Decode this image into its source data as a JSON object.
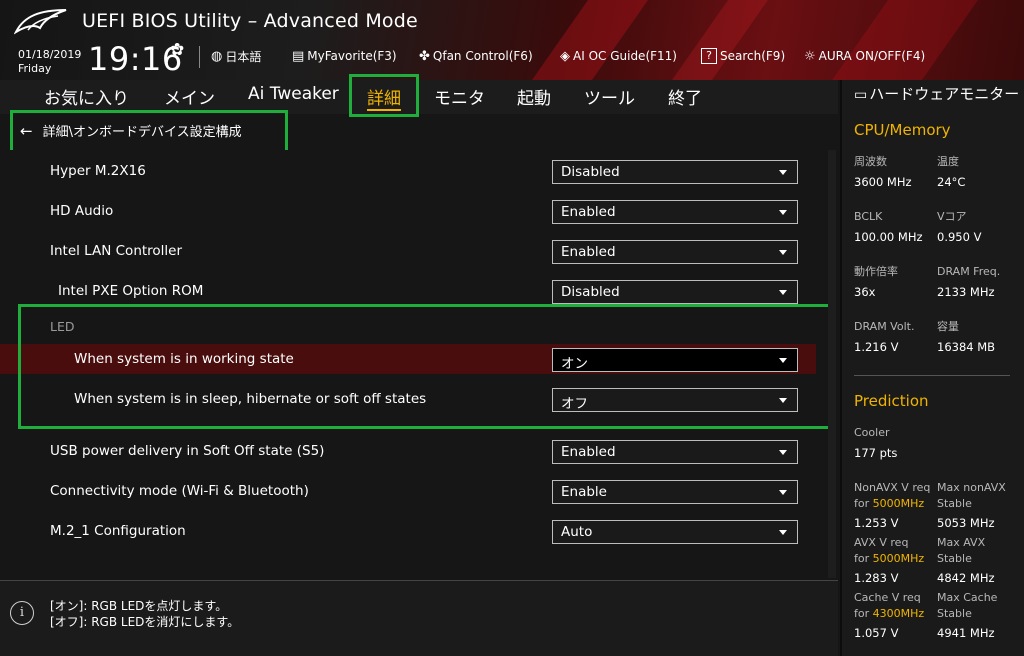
{
  "header": {
    "app_title": "UEFI BIOS Utility – Advanced Mode",
    "date": "01/18/2019",
    "day": "Friday",
    "time": "19:16",
    "tools": [
      {
        "icon": "globe-icon",
        "label": "日本語"
      },
      {
        "icon": "favorite-icon",
        "label": "MyFavorite(F3)"
      },
      {
        "icon": "fan-icon",
        "label": "Qfan Control(F6)"
      },
      {
        "icon": "ai-oc-icon",
        "label": "AI OC Guide(F11)"
      },
      {
        "icon": "search-icon",
        "label": "Search(F9)"
      },
      {
        "icon": "aura-icon",
        "label": "AURA ON/OFF(F4)"
      }
    ]
  },
  "menu": {
    "tabs": [
      {
        "label": "お気に入り"
      },
      {
        "label": "メイン"
      },
      {
        "label": "Ai Tweaker"
      },
      {
        "label": "詳細",
        "active": true
      },
      {
        "label": "モニタ"
      },
      {
        "label": "起動"
      },
      {
        "label": "ツール"
      },
      {
        "label": "終了"
      }
    ]
  },
  "breadcrumb": "詳細\\オンボードデバイス設定構成",
  "settings": {
    "rows": [
      {
        "label": "Hyper M.2X16",
        "value": "Disabled"
      },
      {
        "label": "HD Audio",
        "value": "Enabled"
      },
      {
        "label": "Intel LAN Controller",
        "value": "Enabled"
      },
      {
        "label": "Intel PXE Option ROM",
        "value": "Disabled"
      }
    ],
    "led_section": "LED",
    "led_rows": [
      {
        "label": "When system is in working state",
        "value": "オン"
      },
      {
        "label": "When system is in sleep, hibernate or soft off states",
        "value": "オフ"
      }
    ],
    "rows2": [
      {
        "label": "USB power delivery in Soft Off state (S5)",
        "value": "Enabled"
      },
      {
        "label": "Connectivity mode (Wi-Fi & Bluetooth)",
        "value": "Enable"
      },
      {
        "label": "M.2_1 Configuration",
        "value": "Auto"
      }
    ]
  },
  "help": {
    "line1": "[オン]: RGB LEDを点灯します。",
    "line2": "[オフ]: RGB LEDを消灯にします。"
  },
  "monitor": {
    "title": "ハードウェアモニター",
    "cpu_section": "CPU/Memory",
    "cpu": {
      "freq_label": "周波数",
      "freq_value": "3600 MHz",
      "temp_label": "温度",
      "temp_value": "24°C",
      "bclk_label": "BCLK",
      "bclk_value": "100.00 MHz",
      "vcore_label": "Vコア",
      "vcore_value": "0.950 V",
      "ratio_label": "動作倍率",
      "ratio_value": "36x",
      "dram_freq_label": "DRAM Freq.",
      "dram_freq_value": "2133 MHz",
      "dram_volt_label": "DRAM Volt.",
      "dram_volt_value": "1.216 V",
      "capacity_label": "容量",
      "capacity_value": "16384 MB"
    },
    "prediction_section": "Prediction",
    "prediction": {
      "cooler_label": "Cooler",
      "cooler_value": "177 pts",
      "nonavx_req_label": "NonAVX V req",
      "nonavx_for": "for ",
      "nonavx_freq": "5000MHz",
      "nonavx_req_value": "1.253 V",
      "max_nonavx_label1": "Max nonAVX",
      "max_nonavx_label2": "Stable",
      "max_nonavx_value": "5053 MHz",
      "avx_req_label": "AVX V req",
      "avx_for": "for ",
      "avx_freq": "5000MHz",
      "avx_req_value": "1.283 V",
      "max_avx_label1": "Max AVX",
      "max_avx_label2": "Stable",
      "max_avx_value": "4842 MHz",
      "cache_req_label": "Cache V req",
      "cache_for": "for ",
      "cache_freq": "4300MHz",
      "cache_req_value": "1.057 V",
      "max_cache_label1": "Max Cache",
      "max_cache_label2": "Stable",
      "max_cache_value": "4941 MHz"
    }
  },
  "colors": {
    "accent": "#f0b400",
    "highlight_box": "#1fad3b",
    "selected_row": "#4a0d0d"
  }
}
